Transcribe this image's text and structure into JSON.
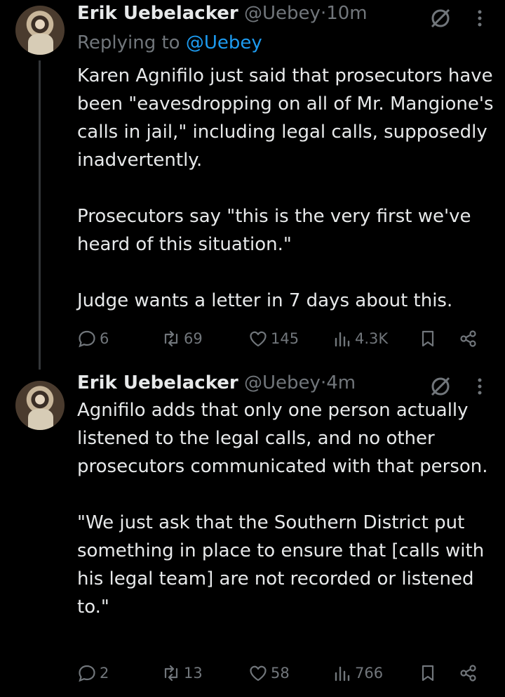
{
  "tweets": [
    {
      "author_name": "Erik Uebelacker",
      "handle": "@Uebey",
      "dot": "·",
      "time": "10m",
      "replying_label": "Replying to ",
      "replying_mention": "@Uebey",
      "text": "Karen Agnifilo just said that prosecutors have been \"eavesdropping on all of Mr. Mangione's calls in jail,\" including legal calls, supposedly inadvertently.\n\nProsecutors say \"this is the very first we've heard of this situation.\"\n\nJudge wants a letter in 7 days about this.",
      "replies": "6",
      "reposts": "69",
      "likes": "145",
      "views": "4.3K"
    },
    {
      "author_name": "Erik Uebelacker",
      "handle": "@Uebey",
      "dot": "·",
      "time": "4m",
      "text": "Agnifilo adds that only one person actually listened to the legal calls, and no other prosecutors communicated with that person.\n\n\"We just ask that the Southern District put something in place to ensure that [calls with his legal team] are not recorded or listened to.\"",
      "replies": "2",
      "reposts": "13",
      "likes": "58",
      "views": "766"
    }
  ],
  "icons": {
    "reply": "reply-icon",
    "repost": "repost-icon",
    "like": "heart-icon",
    "views": "views-icon",
    "bookmark": "bookmark-icon",
    "share": "share-icon",
    "grok": "grok-icon",
    "more": "more-icon"
  },
  "colors": {
    "background": "#000000",
    "text": "#e7e9ea",
    "muted": "#71767b",
    "link": "#1d9bf0"
  }
}
